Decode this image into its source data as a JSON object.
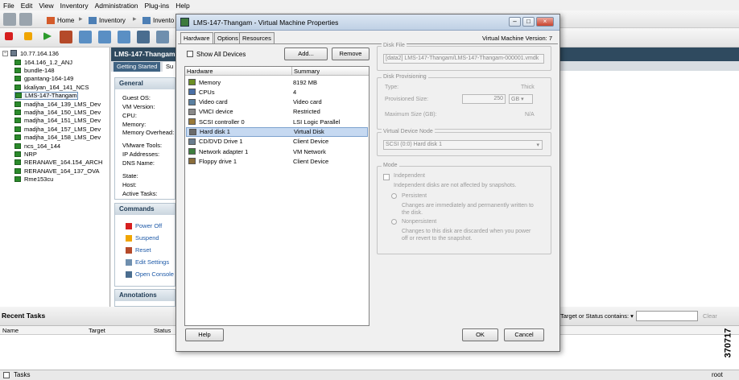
{
  "menu": [
    "File",
    "Edit",
    "View",
    "Inventory",
    "Administration",
    "Plug-ins",
    "Help"
  ],
  "nav": {
    "home": "Home",
    "inventory": "Inventory",
    "inventory_trunc": "Invento"
  },
  "tree": {
    "root": "10.77.164.136",
    "items": [
      "164.146_1.2_ANJ",
      "bundle-148",
      "gpantang-164-149",
      "kkaliyan_164_141_NCS",
      "LMS-147-Thangam",
      "madjha_164_139_LMS_Dev",
      "madjha_164_150_LMS_Dev",
      "madjha_164_151_LMS_Dev",
      "madjha_164_157_LMS_Dev",
      "madjha_164_158_LMS_Dev",
      "ncs_164_144",
      "NRP",
      "RERANAVE_164.154_ARCH",
      "RERANAVE_164_137_OVA",
      "Rme153cu"
    ]
  },
  "vmpanel": {
    "title": "LMS-147-Thangam",
    "tab_getting_started": "Getting Started",
    "tab_summary_trunc": "Su",
    "general_header": "General",
    "general_labels": [
      "Guest OS:",
      "VM Version:",
      "CPU:",
      "Memory:",
      "Memory Overhead:",
      "VMware Tools:",
      "IP Addresses:",
      "DNS Name:",
      "State:",
      "Host:",
      "Active Tasks:"
    ],
    "commands_header": "Commands",
    "commands": [
      "Power Off",
      "Suspend",
      "Reset",
      "Edit Settings",
      "Open Console"
    ],
    "annotations_header": "Annotations"
  },
  "tasks": {
    "title": "Recent Tasks",
    "filter_label": "Target or Status contains:",
    "clear": "Clear",
    "columns": [
      "Name",
      "Target",
      "Status"
    ]
  },
  "statusbar": {
    "tasks": "Tasks",
    "user": "root"
  },
  "dialog": {
    "title": "LMS-147-Thangam - Virtual Machine Properties",
    "tabs": [
      "Hardware",
      "Options",
      "Resources"
    ],
    "vm_version": "Virtual Machine Version: 7",
    "show_all": "Show All Devices",
    "add": "Add...",
    "remove": "Remove",
    "col_hardware": "Hardware",
    "col_summary": "Summary",
    "rows": [
      {
        "hardware": "Memory",
        "summary": "8192 MB",
        "icon": "memory-icon"
      },
      {
        "hardware": "CPUs",
        "summary": "4",
        "icon": "cpu-icon"
      },
      {
        "hardware": "Video card",
        "summary": "Video card",
        "icon": "video-card-icon"
      },
      {
        "hardware": "VMCI device",
        "summary": "Restricted",
        "icon": "vmci-icon"
      },
      {
        "hardware": "SCSI controller 0",
        "summary": "LSI Logic Parallel",
        "icon": "scsi-icon"
      },
      {
        "hardware": "Hard disk 1",
        "summary": "Virtual Disk",
        "icon": "hard-disk-icon"
      },
      {
        "hardware": "CD/DVD Drive 1",
        "summary": "Client Device",
        "icon": "cd-dvd-icon"
      },
      {
        "hardware": "Network adapter 1",
        "summary": "VM Network",
        "icon": "network-icon"
      },
      {
        "hardware": "Floppy drive 1",
        "summary": "Client Device",
        "icon": "floppy-icon"
      }
    ],
    "selected_row": 5,
    "disk_file_legend": "Disk File",
    "disk_file_value": "[data2] LMS-147-Thangam/LMS-147-Thangam-000001.vmdk",
    "provisioning_legend": "Disk Provisioning",
    "type_label": "Type:",
    "type_value": "Thick",
    "prov_size_label": "Provisioned Size:",
    "prov_size_value": "250",
    "prov_unit": "GB",
    "max_size_label": "Maximum Size (GB):",
    "max_size_value": "N/A",
    "vdn_legend": "Virtual Device Node",
    "vdn_value": "SCSI (0:0) Hard disk 1",
    "mode_legend": "Mode",
    "independent": "Independent",
    "independent_desc": "Independent disks are not affected by snapshots.",
    "persistent": "Persistent",
    "persistent_desc1": "Changes are immediately and permanently written to",
    "persistent_desc2": "the disk.",
    "nonpersistent": "Nonpersistent",
    "nonpersistent_desc1": "Changes to this disk are discarded when you power",
    "nonpersistent_desc2": "off or revert to the snapshot.",
    "help": "Help",
    "ok": "OK",
    "cancel": "Cancel"
  },
  "figure_id": "370717",
  "colors": {
    "vm_header": "#2f4a5f",
    "selection": "#c6d9f1",
    "link": "#1e5aa8",
    "vm_icon": "#2b8a2b"
  }
}
